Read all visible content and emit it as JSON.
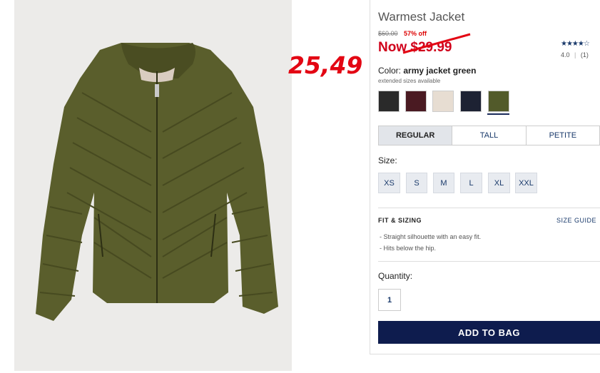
{
  "product": {
    "title": "Warmest Jacket",
    "was_price": "$60.00",
    "discount": "57% off",
    "now_price": "Now $29.99",
    "handwritten_price": "25,49",
    "stars": "★★★★☆",
    "rating": "4.0",
    "reviews": "(1)"
  },
  "color": {
    "label": "Color:",
    "selected": "army jacket green",
    "note": "extended sizes available",
    "swatches": [
      {
        "name": "black",
        "hex": "#2a2a2a"
      },
      {
        "name": "burgundy",
        "hex": "#4a1a22"
      },
      {
        "name": "cream",
        "hex": "#e7ddd2"
      },
      {
        "name": "navy",
        "hex": "#1d2233"
      },
      {
        "name": "army jacket green",
        "hex": "#525a2a"
      }
    ]
  },
  "fits": [
    "REGULAR",
    "TALL",
    "PETITE"
  ],
  "size": {
    "label": "Size:",
    "options": [
      "XS",
      "S",
      "M",
      "L",
      "XL",
      "XXL"
    ]
  },
  "fit_sizing": {
    "title": "FIT & SIZING",
    "guide": "SIZE GUIDE",
    "bullets": [
      "- Straight silhouette with an easy fit.",
      "- Hits below the hip."
    ]
  },
  "quantity": {
    "label": "Quantity:",
    "value": "1"
  },
  "cta": {
    "add_to_bag": "ADD TO BAG"
  },
  "colors": {
    "accent": "#0e1c4e",
    "sale": "#d0021b",
    "link": "#1a3a6b"
  }
}
